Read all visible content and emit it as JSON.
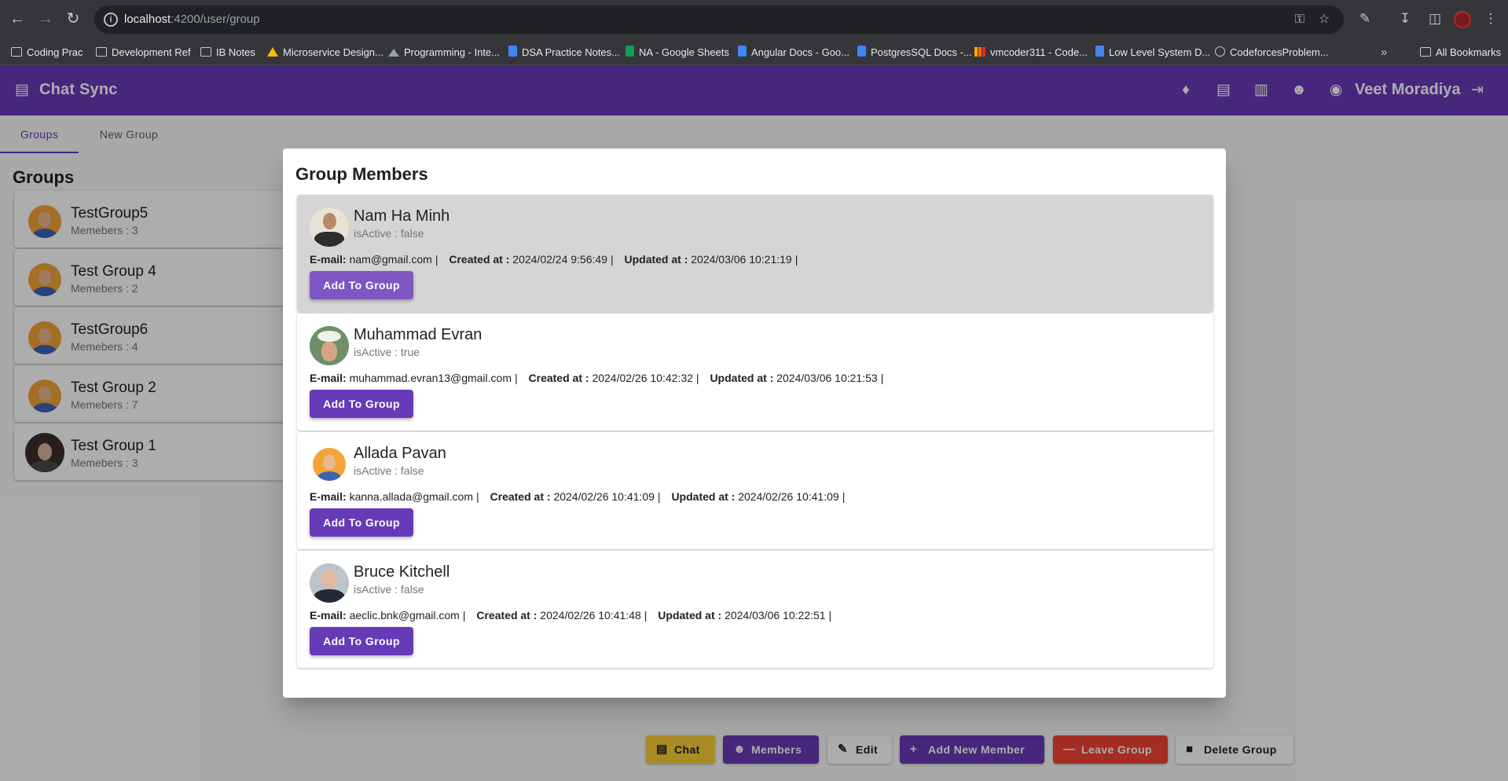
{
  "browser": {
    "url_host": "localhost",
    "url_path": ":4200/user/group",
    "bookmarks": [
      {
        "label": "Coding Prac",
        "icon": "folder-icon"
      },
      {
        "label": "Development Ref",
        "icon": "folder-icon"
      },
      {
        "label": "IB Notes",
        "icon": "folder-icon"
      },
      {
        "label": "Microservice Design...",
        "icon": "drive-icon"
      },
      {
        "label": "Programming - Inte...",
        "icon": "mountain-icon"
      },
      {
        "label": "DSA Practice Notes...",
        "icon": "doc-icon"
      },
      {
        "label": "NA - Google Sheets",
        "icon": "sheet-icon"
      },
      {
        "label": "Angular Docs - Goo...",
        "icon": "doc-icon"
      },
      {
        "label": "PostgresSQL Docs -...",
        "icon": "doc-icon"
      },
      {
        "label": "vmcoder311 - Code...",
        "icon": "bars-icon"
      },
      {
        "label": "Low Level System D...",
        "icon": "doc-icon"
      },
      {
        "label": "CodeforcesProblem...",
        "icon": "globe-icon"
      },
      {
        "label": "All Bookmarks",
        "icon": "folder-icon"
      }
    ]
  },
  "app": {
    "title": "Chat Sync",
    "user_name": "Veet Moradiya",
    "accent": "#673ab7",
    "tabs": [
      "Groups",
      "New Group"
    ],
    "groups_heading": "Groups",
    "groups": [
      {
        "name": "TestGroup5",
        "members": "Memebers : 3"
      },
      {
        "name": "Test Group 4",
        "members": "Memebers : 2"
      },
      {
        "name": "TestGroup6",
        "members": "Memebers : 4"
      },
      {
        "name": "Test Group 2",
        "members": "Memebers : 7"
      },
      {
        "name": "Test Group 1",
        "members": "Memebers : 3"
      }
    ],
    "actions": [
      {
        "label": "Chat",
        "icon": "chat-icon",
        "color": "#f9ce38"
      },
      {
        "label": "Members",
        "icon": "people-icon",
        "color": "#673ab7"
      },
      {
        "label": "Edit",
        "icon": "pencil-icon",
        "color": "#ffffff"
      },
      {
        "label": "Add New Member",
        "icon": "plus-icon",
        "color": "#673ab7"
      },
      {
        "label": "Leave Group",
        "icon": "minus-icon",
        "color": "#f44336"
      },
      {
        "label": "Delete Group",
        "icon": "trash-icon",
        "color": "#ffffff"
      }
    ]
  },
  "dialog": {
    "title": "Group Members",
    "field_labels": {
      "email": "E-mail:",
      "created": "Created at :",
      "updated": "Updated at :",
      "separator": "|"
    },
    "button_label": "Add To Group",
    "members": [
      {
        "name": "Nam Ha Minh",
        "status": "isActive : false",
        "email": "nam@gmail.com",
        "created": "2024/02/24 9:56:49",
        "updated": "2024/03/06 10:21:19"
      },
      {
        "name": "Muhammad Evran",
        "status": "isActive : true",
        "email": "muhammad.evran13@gmail.com",
        "created": "2024/02/26 10:42:32",
        "updated": "2024/03/06 10:21:53"
      },
      {
        "name": "Allada Pavan",
        "status": "isActive : false",
        "email": "kanna.allada@gmail.com",
        "created": "2024/02/26 10:41:09",
        "updated": "2024/02/26 10:41:09"
      },
      {
        "name": "Bruce Kitchell",
        "status": "isActive : false",
        "email": "aeclic.bnk@gmail.com",
        "created": "2024/02/26 10:41:48",
        "updated": "2024/03/06 10:22:51"
      }
    ]
  }
}
